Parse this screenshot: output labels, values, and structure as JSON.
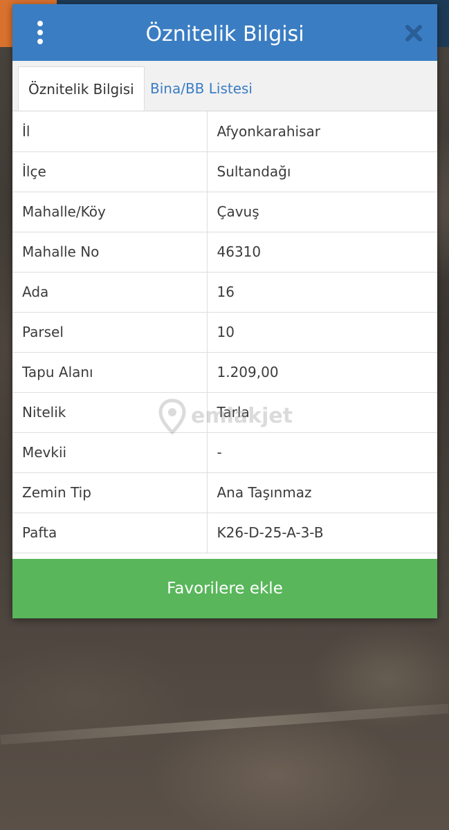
{
  "dialog": {
    "title": "Öznitelik Bilgisi",
    "tabs": [
      {
        "label": "Öznitelik Bilgisi",
        "active": true
      },
      {
        "label": "Bina/BB Listesi",
        "active": false
      }
    ],
    "rows": [
      {
        "key": "İl",
        "value": "Afyonkarahisar"
      },
      {
        "key": "İlçe",
        "value": "Sultandağı"
      },
      {
        "key": "Mahalle/Köy",
        "value": "Çavuş"
      },
      {
        "key": "Mahalle No",
        "value": "46310"
      },
      {
        "key": "Ada",
        "value": "16"
      },
      {
        "key": "Parsel",
        "value": "10"
      },
      {
        "key": "Tapu Alanı",
        "value": "1.209,00"
      },
      {
        "key": "Nitelik",
        "value": "Tarla"
      },
      {
        "key": "Mevkii",
        "value": "-"
      },
      {
        "key": "Zemin Tip",
        "value": "Ana Taşınmaz"
      },
      {
        "key": "Pafta",
        "value": "K26-D-25-A-3-B"
      }
    ],
    "favorite_button": "Favorilere ekle"
  },
  "watermark": {
    "text": "emlakjet"
  },
  "icons": {
    "menu": "kebab-menu-icon",
    "close": "close-icon",
    "watermark": "location-pin-icon"
  },
  "colors": {
    "header": "#3a7dc3",
    "tab_link": "#3a7dc3",
    "button": "#59b65b"
  }
}
